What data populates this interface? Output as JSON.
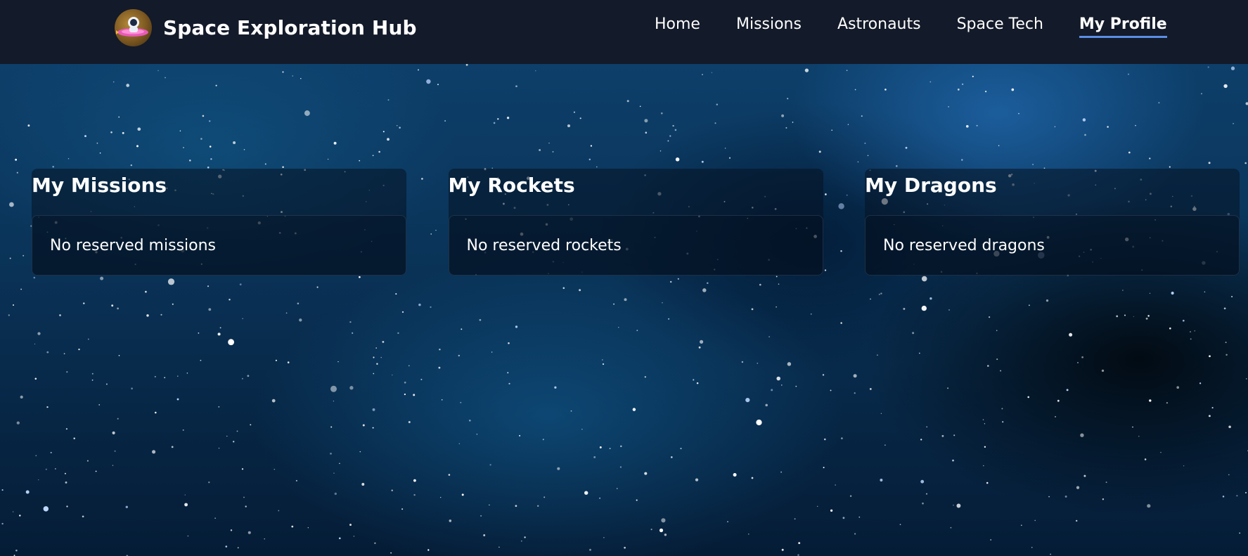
{
  "header": {
    "brand_title": "Space Exploration Hub",
    "logo_icon": "astronaut-rocket-logo-icon",
    "nav": [
      {
        "label": "Home",
        "active": false
      },
      {
        "label": "Missions",
        "active": false
      },
      {
        "label": "Astronauts",
        "active": false
      },
      {
        "label": "Space Tech",
        "active": false
      },
      {
        "label": "My Profile",
        "active": true
      }
    ],
    "active_underline_color": "#5b8ee6"
  },
  "profile": {
    "missions": {
      "title": "My Missions",
      "empty_text": "No reserved missions"
    },
    "rockets": {
      "title": "My Rockets",
      "empty_text": "No reserved rockets"
    },
    "dragons": {
      "title": "My Dragons",
      "empty_text": "No reserved dragons"
    }
  },
  "colors": {
    "header_bg": "#131a29",
    "text": "#ffffff"
  }
}
